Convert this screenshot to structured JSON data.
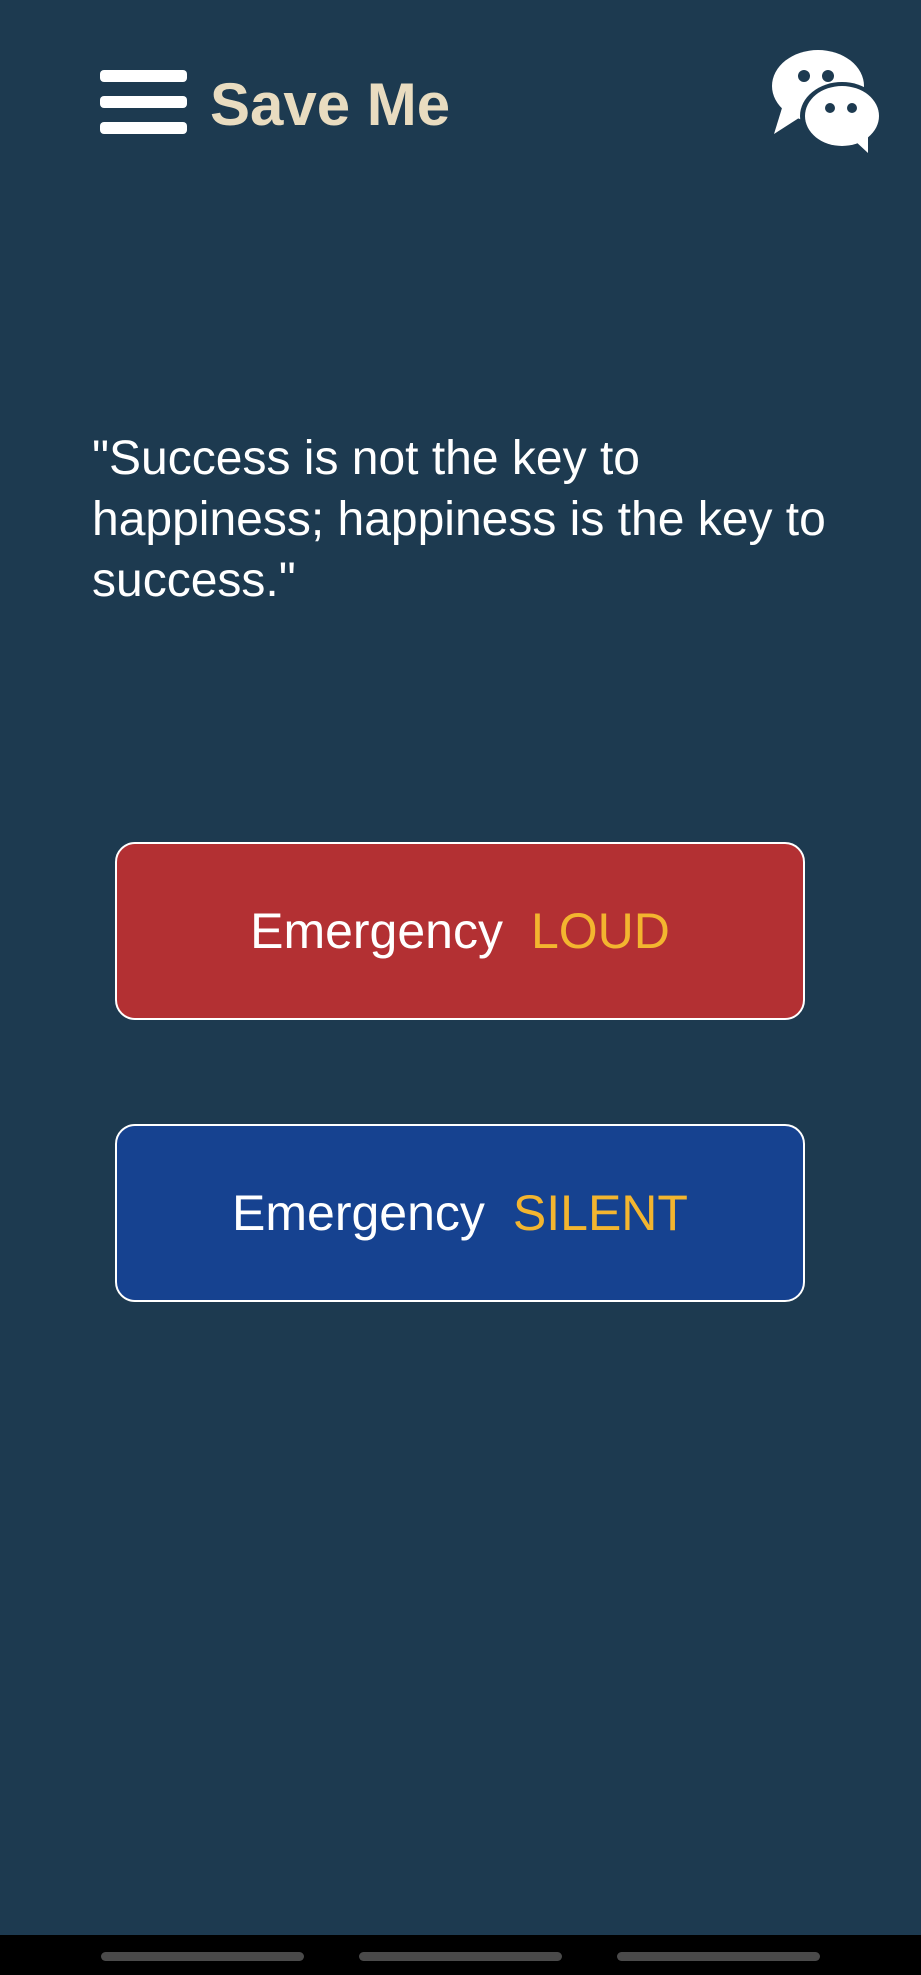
{
  "header": {
    "menu_icon": "hamburger-menu-icon",
    "title": "Save Me",
    "chat_icon": "wechat-chat-bubbles-icon"
  },
  "quote": {
    "text": "\"Success is not the key to happiness; happiness is the key to success.\""
  },
  "buttons": [
    {
      "label": "Emergency",
      "mode": "LOUD",
      "color": "#b33033"
    },
    {
      "label": "Emergency",
      "mode": "SILENT",
      "color": "#164290"
    }
  ],
  "colors": {
    "background": "#1d3a50",
    "title": "#e9dcc0",
    "accent": "#f3b52f"
  }
}
